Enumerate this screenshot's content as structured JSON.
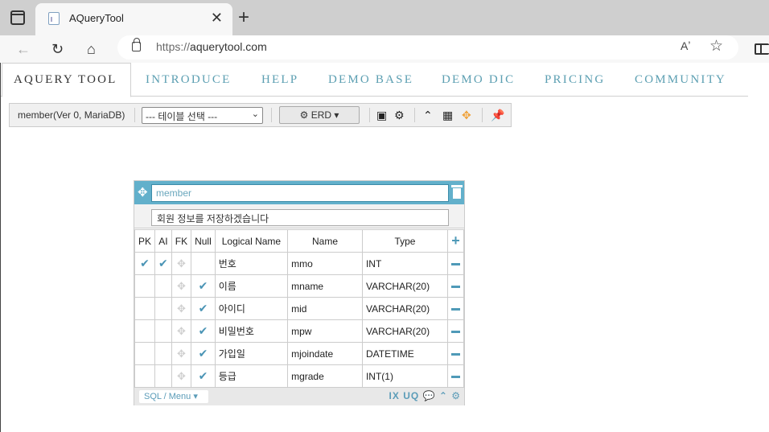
{
  "browser": {
    "tab_title": "AQueryTool",
    "new_tab": "+",
    "tab_close": "✕",
    "url_scheme": "https://",
    "url_host": "aquerytool.com",
    "read_aloud": "Aʼ",
    "favorite": "☆"
  },
  "nav": {
    "items": [
      "AQUERY TOOL",
      "INTRODUCE",
      "HELP",
      "DEMO BASE",
      "DEMO DIC",
      "PRICING",
      "COMMUNITY"
    ]
  },
  "toolbar": {
    "db_label": "member(Ver 0, MariaDB)",
    "table_select": "--- 테이블 선택 ---",
    "erd_label": "ERD"
  },
  "entity": {
    "name_placeholder": "member",
    "comment": "회원 정보를 저장하겠습니다",
    "headers": [
      "PK",
      "AI",
      "FK",
      "Null",
      "Logical Name",
      "Name",
      "Type"
    ],
    "rows": [
      {
        "pk": true,
        "ai": true,
        "fk": true,
        "null": false,
        "logical": "번호",
        "name": "mmo",
        "type": "INT"
      },
      {
        "pk": false,
        "ai": false,
        "fk": true,
        "null": true,
        "logical": "이름",
        "name": "mname",
        "type": "VARCHAR(20)"
      },
      {
        "pk": false,
        "ai": false,
        "fk": true,
        "null": true,
        "logical": "아이디",
        "name": "mid",
        "type": "VARCHAR(20)"
      },
      {
        "pk": false,
        "ai": false,
        "fk": true,
        "null": true,
        "logical": "비밀번호",
        "name": "mpw",
        "type": "VARCHAR(20)"
      },
      {
        "pk": false,
        "ai": false,
        "fk": true,
        "null": true,
        "logical": "가입일",
        "name": "mjoindate",
        "type": "DATETIME"
      },
      {
        "pk": false,
        "ai": false,
        "fk": true,
        "null": true,
        "logical": "등급",
        "name": "mgrade",
        "type": "INT(1)"
      }
    ],
    "footer_menu": "SQL / Menu",
    "footer_icons": "IX UQ"
  },
  "colors": {
    "accent": "#62b0cb",
    "nav_text": "#5c9fb2",
    "check": "#4a94b5"
  }
}
